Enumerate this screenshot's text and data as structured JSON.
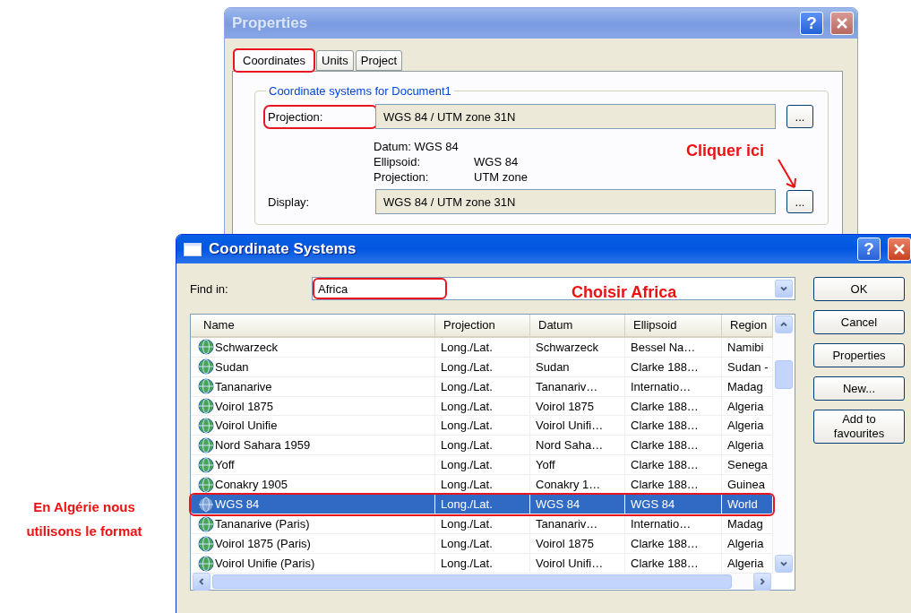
{
  "properties_dialog": {
    "title": "Properties",
    "help": "?",
    "tabs": [
      {
        "label": "Coordinates",
        "selected": true,
        "highlighted": true
      },
      {
        "label": "Units",
        "selected": false,
        "highlighted": false
      },
      {
        "label": "Project",
        "selected": false,
        "highlighted": false
      }
    ],
    "group_title": "Coordinate systems for Document1",
    "projection": {
      "label": "Projection:",
      "highlighted": true,
      "value": "WGS 84 / UTM zone 31N",
      "button": "..."
    },
    "details": [
      {
        "label": "Datum:",
        "value": "WGS 84",
        "kind": "inline"
      },
      {
        "label": "Ellipsoid:",
        "value": "WGS 84",
        "kind": "column"
      },
      {
        "label": "Projection:",
        "value": "UTM zone",
        "kind": "column"
      }
    ],
    "display": {
      "label": "Display:",
      "highlighted": false,
      "value": "WGS 84 / UTM zone 31N",
      "button": "..."
    }
  },
  "coordinate_systems_dialog": {
    "title": "Coordinate Systems",
    "help": "?",
    "find_in": {
      "label": "Find in:",
      "value": "Africa",
      "highlighted": true
    },
    "columns": [
      "Name",
      "Projection",
      "Datum",
      "Ellipsoid",
      "Region"
    ],
    "rows": [
      {
        "cells": [
          "Schwarzeck",
          "Long./Lat.",
          "Schwarzeck",
          "Bessel Na…",
          "Namibi"
        ],
        "selected": false,
        "highlighted": false
      },
      {
        "cells": [
          "Sudan",
          "Long./Lat.",
          "Sudan",
          "Clarke 188…",
          "Sudan -"
        ],
        "selected": false,
        "highlighted": false
      },
      {
        "cells": [
          "Tananarive",
          "Long./Lat.",
          "Tananariv…",
          "Internatio…",
          "Madag"
        ],
        "selected": false,
        "highlighted": false
      },
      {
        "cells": [
          "Voirol 1875",
          "Long./Lat.",
          "Voirol 1875",
          "Clarke 188…",
          "Algeria"
        ],
        "selected": false,
        "highlighted": false
      },
      {
        "cells": [
          "Voirol Unifie",
          "Long./Lat.",
          "Voirol Unifi…",
          "Clarke 188…",
          "Algeria"
        ],
        "selected": false,
        "highlighted": false
      },
      {
        "cells": [
          "Nord Sahara 1959",
          "Long./Lat.",
          "Nord Saha…",
          "Clarke 188…",
          "Algeria"
        ],
        "selected": false,
        "highlighted": false
      },
      {
        "cells": [
          "Yoff",
          "Long./Lat.",
          "Yoff",
          "Clarke 188…",
          "Senega"
        ],
        "selected": false,
        "highlighted": false
      },
      {
        "cells": [
          "Conakry 1905",
          "Long./Lat.",
          "Conakry 1…",
          "Clarke 188…",
          "Guinea"
        ],
        "selected": false,
        "highlighted": false
      },
      {
        "cells": [
          "WGS 84",
          "Long./Lat.",
          "WGS 84",
          "WGS 84",
          "World"
        ],
        "selected": true,
        "highlighted": true
      },
      {
        "cells": [
          "Tananarive (Paris)",
          "Long./Lat.",
          "Tananariv…",
          "Internatio…",
          "Madag"
        ],
        "selected": false,
        "highlighted": false
      },
      {
        "cells": [
          "Voirol 1875 (Paris)",
          "Long./Lat.",
          "Voirol 1875",
          "Clarke 188…",
          "Algeria"
        ],
        "selected": false,
        "highlighted": false
      },
      {
        "cells": [
          "Voirol Unifie (Paris)",
          "Long./Lat.",
          "Voirol Unifi…",
          "Clarke 188…",
          "Algeria"
        ],
        "selected": false,
        "highlighted": false
      }
    ],
    "buttons": [
      "OK",
      "Cancel",
      "Properties",
      "New...",
      "Add to favourites"
    ]
  },
  "click_note": "Cliquer ici",
  "find_note": "Choisir Africa",
  "side_note": "En Algérie nous utilisons le format"
}
